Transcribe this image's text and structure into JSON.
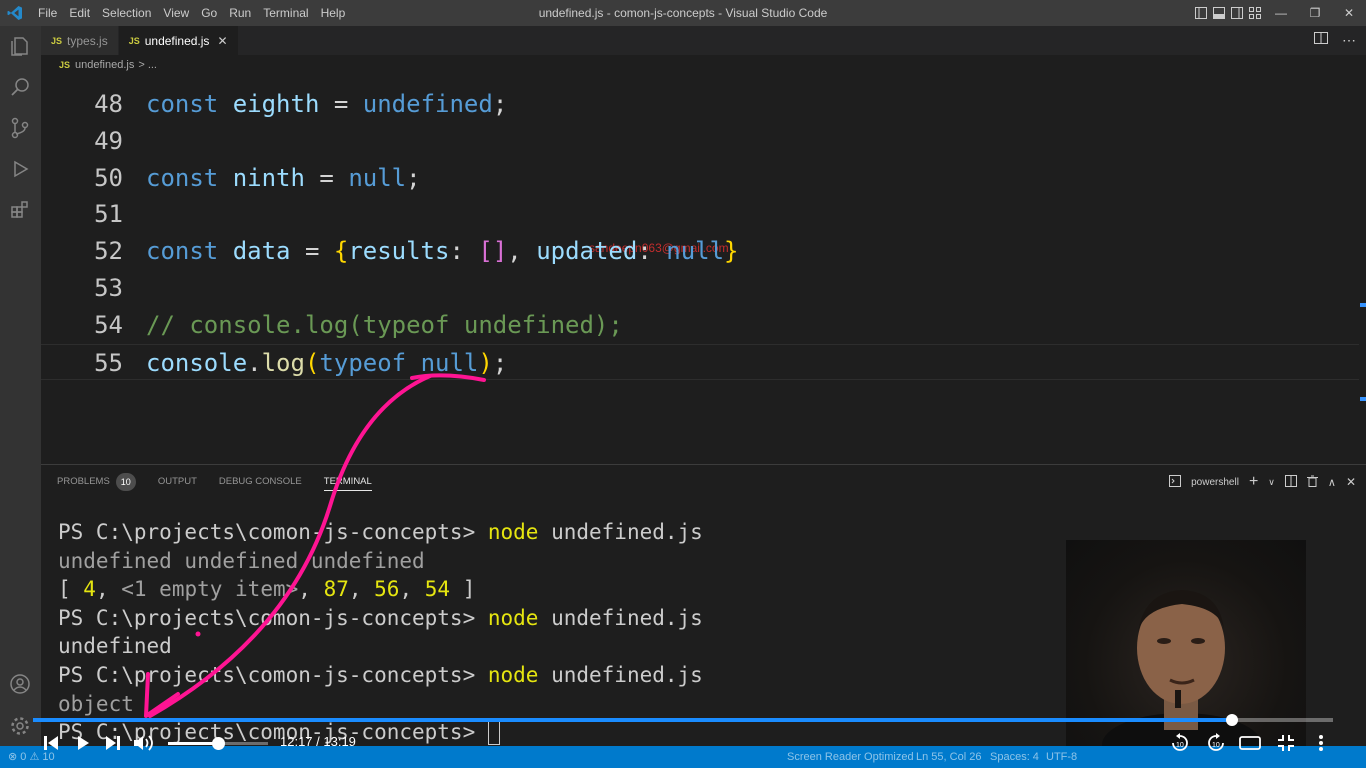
{
  "titlebar": {
    "menu": [
      "File",
      "Edit",
      "Selection",
      "View",
      "Go",
      "Run",
      "Terminal",
      "Help"
    ],
    "window_title": "undefined.js - comon-js-concepts - Visual Studio Code"
  },
  "tabs": [
    {
      "badge": "JS",
      "label": "types.js",
      "active": false
    },
    {
      "badge": "JS",
      "label": "undefined.js",
      "active": true,
      "close": "✕"
    }
  ],
  "breadcrumb": {
    "badge": "JS",
    "file": "undefined.js",
    "rest": "> ..."
  },
  "editor": {
    "lines": [
      {
        "num": "48",
        "tokens": [
          {
            "t": "const ",
            "c": "kw"
          },
          {
            "t": "eighth",
            "c": "var"
          },
          {
            "t": " = ",
            "c": "op"
          },
          {
            "t": "undefined",
            "c": "kw"
          },
          {
            "t": ";",
            "c": "op"
          }
        ]
      },
      {
        "num": "49",
        "tokens": []
      },
      {
        "num": "50",
        "tokens": [
          {
            "t": "const ",
            "c": "kw"
          },
          {
            "t": "ninth",
            "c": "var"
          },
          {
            "t": " = ",
            "c": "op"
          },
          {
            "t": "null",
            "c": "kw"
          },
          {
            "t": ";",
            "c": "op"
          }
        ]
      },
      {
        "num": "51",
        "tokens": []
      },
      {
        "num": "52",
        "tokens": [
          {
            "t": "const ",
            "c": "kw"
          },
          {
            "t": "data",
            "c": "var"
          },
          {
            "t": " = ",
            "c": "op"
          },
          {
            "t": "{",
            "c": "brace"
          },
          {
            "t": "results",
            "c": "var"
          },
          {
            "t": ": ",
            "c": "op"
          },
          {
            "t": "[]",
            "c": "bracket"
          },
          {
            "t": ", ",
            "c": "op"
          },
          {
            "t": "updated",
            "c": "var"
          },
          {
            "t": ": ",
            "c": "op"
          },
          {
            "t": "null",
            "c": "kw"
          },
          {
            "t": "}",
            "c": "brace"
          }
        ]
      },
      {
        "num": "53",
        "tokens": []
      },
      {
        "num": "54",
        "tokens": [
          {
            "t": "// console.log(typeof undefined);",
            "c": "cmt"
          }
        ]
      },
      {
        "num": "55",
        "tokens": [
          {
            "t": "console",
            "c": "var"
          },
          {
            "t": ".",
            "c": "op"
          },
          {
            "t": "log",
            "c": "fn"
          },
          {
            "t": "(",
            "c": "paren"
          },
          {
            "t": "typeof ",
            "c": "kw"
          },
          {
            "t": "null",
            "c": "kw"
          },
          {
            "t": ")",
            "c": "paren"
          },
          {
            "t": ";",
            "c": "op"
          }
        ],
        "current": true
      }
    ],
    "watermark": "sandeepn063@gmail.com"
  },
  "panel": {
    "tabs": [
      {
        "label": "PROBLEMS",
        "badge": "10",
        "active": false
      },
      {
        "label": "OUTPUT",
        "active": false
      },
      {
        "label": "DEBUG CONSOLE",
        "active": false
      },
      {
        "label": "TERMINAL",
        "active": true
      }
    ],
    "shell": "powershell",
    "terminal_lines": [
      [
        {
          "t": "PS C:\\projects\\comon-js-concepts> ",
          "c": ""
        },
        {
          "t": "node",
          "c": "t-yel"
        },
        {
          "t": " undefined.js",
          "c": ""
        }
      ],
      [
        {
          "t": "undefined undefined undefined",
          "c": "t-dim"
        }
      ],
      [
        {
          "t": "[ ",
          "c": ""
        },
        {
          "t": "4",
          "c": "t-yel"
        },
        {
          "t": ", ",
          "c": ""
        },
        {
          "t": "<1 empty item>",
          "c": "t-dim"
        },
        {
          "t": ", ",
          "c": ""
        },
        {
          "t": "87",
          "c": "t-yel"
        },
        {
          "t": ", ",
          "c": ""
        },
        {
          "t": "56",
          "c": "t-yel"
        },
        {
          "t": ", ",
          "c": ""
        },
        {
          "t": "54",
          "c": "t-yel"
        },
        {
          "t": " ]",
          "c": ""
        }
      ],
      [
        {
          "t": "PS C:\\projects\\comon-js-concepts> ",
          "c": ""
        },
        {
          "t": "node",
          "c": "t-yel"
        },
        {
          "t": " undefined.js",
          "c": ""
        }
      ],
      [
        {
          "t": "undefined",
          "c": ""
        }
      ],
      [
        {
          "t": "PS C:\\projects\\comon-js-concepts> ",
          "c": ""
        },
        {
          "t": "node",
          "c": "t-yel"
        },
        {
          "t": " undefined.js",
          "c": ""
        }
      ],
      [
        {
          "t": "object",
          "c": "t-dim"
        }
      ],
      [
        {
          "t": "PS C:\\projects\\comon-js-concepts> ",
          "c": ""
        }
      ]
    ]
  },
  "statusbar": {
    "left": "⊗ 0 ⚠ 10",
    "items": [
      "Screen Reader Optimized",
      "Ln 55, Col 26",
      "Spaces: 4",
      "UTF-8"
    ]
  },
  "video": {
    "time": "12:17 / 13:19",
    "progress": 0.9222,
    "volume": 0.5
  },
  "colors": {
    "accent": "#007acc",
    "annotation": "#ff1493",
    "progress": "#1a8cff"
  }
}
